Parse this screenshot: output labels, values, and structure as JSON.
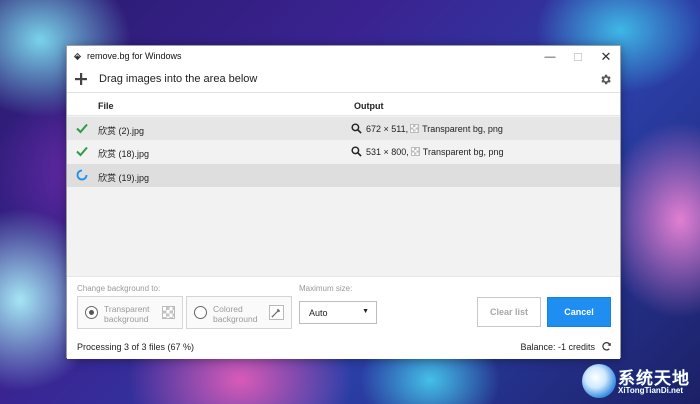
{
  "window": {
    "title": "remove.bg for Windows",
    "controls": {
      "minimize": "—",
      "maximize": "☐",
      "close": "✕"
    }
  },
  "toolbar": {
    "add_icon": "plus-icon",
    "drag_text": "Drag images into the area below",
    "settings_icon": "gear-icon"
  },
  "list": {
    "headers": {
      "file": "File",
      "output": "Output"
    },
    "rows": [
      {
        "status": "done",
        "status_icon": "check-icon",
        "file": "欣赏 (2).jpg",
        "output_dims": "672 × 511,",
        "output_desc": "Transparent bg, png"
      },
      {
        "status": "done",
        "status_icon": "check-icon",
        "file": "欣赏 (18).jpg",
        "output_dims": "531 × 800,",
        "output_desc": "Transparent bg, png"
      },
      {
        "status": "processing",
        "status_icon": "spinner-icon",
        "file": "欣赏 (19).jpg",
        "output_dims": "",
        "output_desc": ""
      }
    ]
  },
  "options": {
    "change_bg_label": "Change background to:",
    "transparent_label_1": "Transparent",
    "transparent_label_2": "background",
    "colored_label_1": "Colored",
    "colored_label_2": "background",
    "selected": "transparent",
    "max_size_label": "Maximum size:",
    "max_size_value": "Auto",
    "max_size_caret": "▼"
  },
  "buttons": {
    "clear": "Clear list",
    "cancel": "Cancel"
  },
  "status": {
    "processing_text": "Processing 3 of 3 files (67 %)",
    "progress_fraction": 0.67,
    "balance_text": "Balance: -1 credits"
  },
  "watermark": {
    "title": "系统天地",
    "subtitle": "XiTongTianDi.net"
  },
  "colors": {
    "accent": "#1e8ef0",
    "check": "#2e9c47",
    "spinner": "#1e8ef0"
  }
}
